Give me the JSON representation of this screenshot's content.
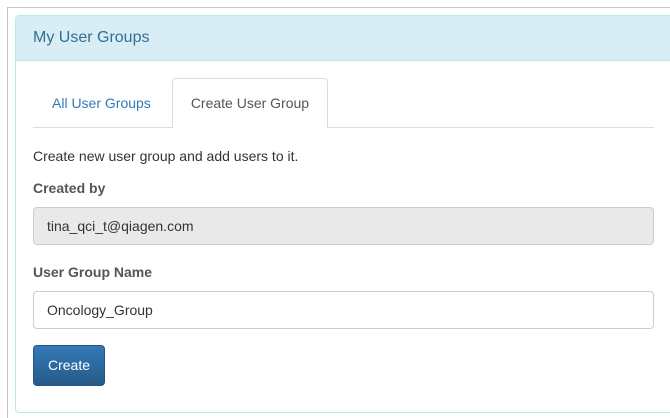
{
  "panel": {
    "title": "My User Groups"
  },
  "tabs": [
    {
      "label": "All User Groups",
      "active": false
    },
    {
      "label": "Create User Group",
      "active": true
    }
  ],
  "form": {
    "description": "Create new user group and add users to it.",
    "created_by_label": "Created by",
    "created_by_value": "tina_qci_t@qiagen.com",
    "group_name_label": "User Group Name",
    "group_name_value": "Oncology_Group",
    "create_button": "Create"
  },
  "colors": {
    "heading_bg": "#d9edf7",
    "heading_text": "#31708f",
    "link": "#337ab7",
    "primary_button": "#2b6aa3"
  }
}
